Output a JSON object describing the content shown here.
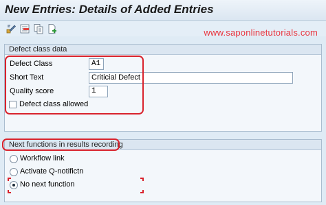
{
  "window": {
    "title": "New Entries: Details of Added Entries"
  },
  "toolbar": {
    "buttons": [
      {
        "icon": "display-change-icon"
      },
      {
        "icon": "delete-icon"
      },
      {
        "icon": "copy-icon"
      },
      {
        "icon": "new-document-icon"
      }
    ]
  },
  "watermark": "www.saponlinetutorials.com",
  "defect_group": {
    "heading": "Defect class data",
    "defect_class": {
      "label": "Defect Class",
      "value": "A1"
    },
    "short_text": {
      "label": "Short Text",
      "value": "Criticial Defect"
    },
    "quality_score": {
      "label": "Quality score",
      "value": "1"
    },
    "allowed": {
      "label": "Defect class allowed",
      "checked": false
    }
  },
  "next_group": {
    "heading": "Next functions in results recording",
    "options": [
      {
        "label": "Workflow link",
        "selected": false
      },
      {
        "label": "Activate Q-notifictn",
        "selected": false
      },
      {
        "label": "No next function",
        "selected": true
      }
    ]
  },
  "colors": {
    "highlight": "#d9222c",
    "background": "#dfebf5"
  }
}
